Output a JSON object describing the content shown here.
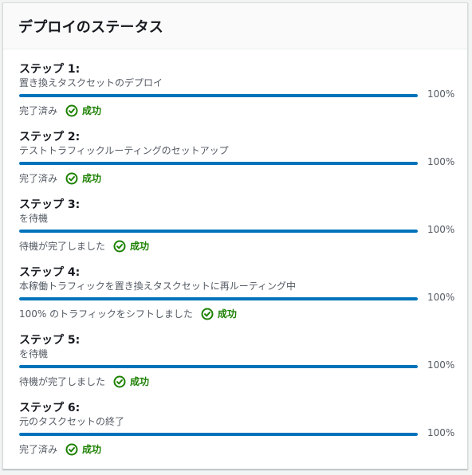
{
  "panel": {
    "title": "デプロイのステータス"
  },
  "colors": {
    "progress": "#0073bb",
    "success": "#1d8102"
  },
  "steps": [
    {
      "title": "ステップ 1:",
      "description": "置き換えタスクセットのデプロイ",
      "progress_percent": 100,
      "percent_label": "100%",
      "status_text": "完了済み",
      "result_label": "成功",
      "result_icon": "check-circle-icon"
    },
    {
      "title": "ステップ 2:",
      "description": "テストトラフィックルーティングのセットアップ",
      "progress_percent": 100,
      "percent_label": "100%",
      "status_text": "完了済み",
      "result_label": "成功",
      "result_icon": "check-circle-icon"
    },
    {
      "title": "ステップ 3:",
      "description": "を待機",
      "progress_percent": 100,
      "percent_label": "100%",
      "status_text": "待機が完了しました",
      "result_label": "成功",
      "result_icon": "check-circle-icon"
    },
    {
      "title": "ステップ 4:",
      "description": "本稼働トラフィックを置き換えタスクセットに再ルーティング中",
      "progress_percent": 100,
      "percent_label": "100%",
      "status_text": "100% のトラフィックをシフトしました",
      "result_label": "成功",
      "result_icon": "check-circle-icon"
    },
    {
      "title": "ステップ 5:",
      "description": "を待機",
      "progress_percent": 100,
      "percent_label": "100%",
      "status_text": "待機が完了しました",
      "result_label": "成功",
      "result_icon": "check-circle-icon"
    },
    {
      "title": "ステップ 6:",
      "description": "元のタスクセットの終了",
      "progress_percent": 100,
      "percent_label": "100%",
      "status_text": "完了済み",
      "result_label": "成功",
      "result_icon": "check-circle-icon"
    }
  ]
}
